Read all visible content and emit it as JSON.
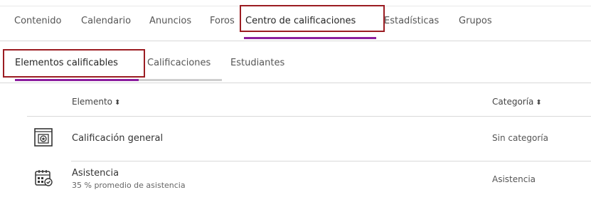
{
  "nav": {
    "tabs": [
      {
        "label": "Contenido"
      },
      {
        "label": "Calendario"
      },
      {
        "label": "Anuncios"
      },
      {
        "label": "Foros"
      },
      {
        "label": "Centro de calificaciones"
      },
      {
        "label": "Estadísticas"
      },
      {
        "label": "Grupos"
      }
    ],
    "active_index": 4
  },
  "subnav": {
    "tabs": [
      {
        "label": "Elementos calificables"
      },
      {
        "label": "Calificaciones"
      },
      {
        "label": "Estudiantes"
      }
    ],
    "active_index": 0
  },
  "table": {
    "columns": {
      "item": "Elemento",
      "category": "Categoría",
      "sort_glyph": "⬍"
    },
    "rows": [
      {
        "icon": "overall-grade-icon",
        "title": "Calificación general",
        "subtitle": "",
        "category": "Sin categoría"
      },
      {
        "icon": "attendance-calendar-icon",
        "title": "Asistencia",
        "subtitle": "35 % promedio de asistencia",
        "category": "Asistencia"
      }
    ]
  },
  "colors": {
    "accent_underline": "#8b1e9e",
    "highlight_box": "#9b1c22",
    "divider": "#d9d9d9"
  }
}
